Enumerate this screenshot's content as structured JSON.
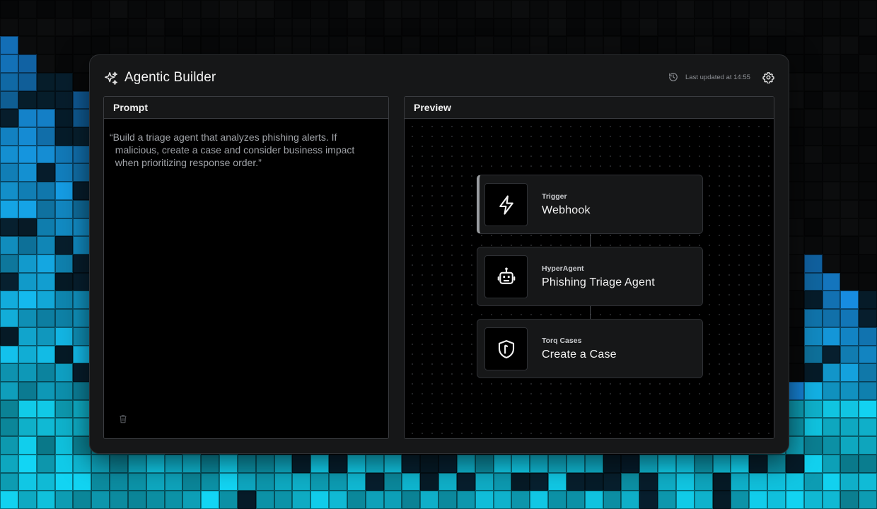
{
  "app": {
    "title": "Agentic Builder",
    "last_updated": "Last updated at 14:55"
  },
  "prompt_panel": {
    "header": "Prompt",
    "text": "“Build a triage agent that analyzes phishing alerts. If\n  malicious, create a case and consider business impact\n  when prioritizing response order.”"
  },
  "preview_panel": {
    "header": "Preview",
    "nodes": [
      {
        "type": "Trigger",
        "name": "Webhook",
        "icon": "lightning-icon"
      },
      {
        "type": "HyperAgent",
        "name": "Phishing Triage Agent",
        "icon": "robot-icon"
      },
      {
        "type": "Torq Cases",
        "name": "Create a Case",
        "icon": "shield-icon"
      }
    ]
  },
  "colors": {
    "background": "#050607",
    "window": "#161718",
    "panel": "#000000",
    "accent_cyan": "#12d6f5",
    "accent_blue": "#1a6fe0"
  }
}
